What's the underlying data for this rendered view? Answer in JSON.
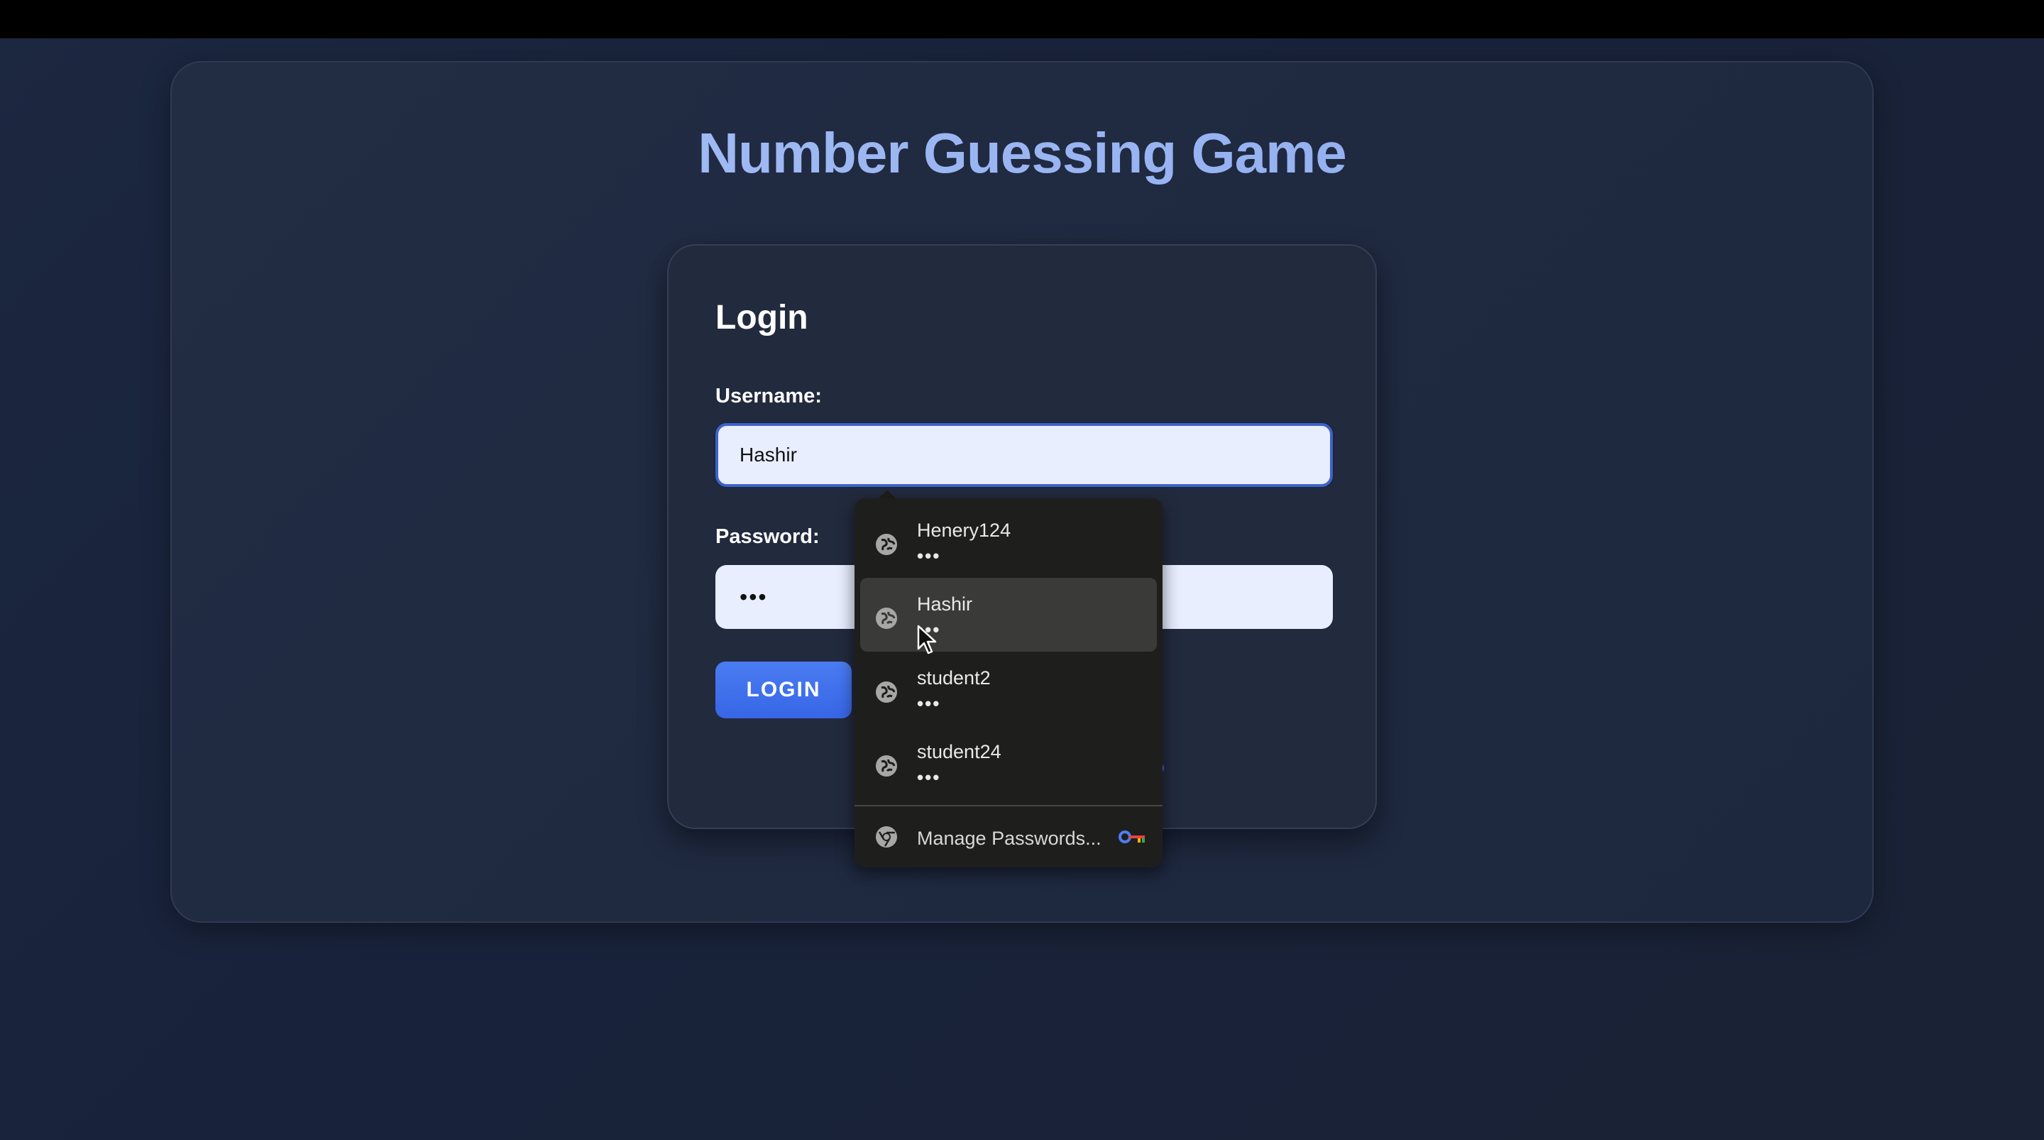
{
  "page": {
    "title": "Number Guessing Game"
  },
  "login": {
    "heading": "Login",
    "username_label": "Username:",
    "username_value": "Hashir",
    "password_label": "Password:",
    "password_value": "•••",
    "button_label": "LOGIN"
  },
  "autofill": {
    "items": [
      {
        "name": "Henery124",
        "dots": "•••",
        "icon": "globe-icon"
      },
      {
        "name": "Hashir",
        "dots": "•••",
        "icon": "globe-icon",
        "selected": true
      },
      {
        "name": "student2",
        "dots": "•••",
        "icon": "globe-icon"
      },
      {
        "name": "student24",
        "dots": "•••",
        "icon": "globe-icon"
      }
    ],
    "manage_label": "Manage Passwords...",
    "manage_icon": "chrome-icon",
    "key_icon": "key-icon"
  },
  "colors": {
    "accent": "#3766e6",
    "title_gradient_start": "#a9c2f5",
    "title_gradient_end": "#8aa8ef",
    "background": "#1c2740"
  }
}
